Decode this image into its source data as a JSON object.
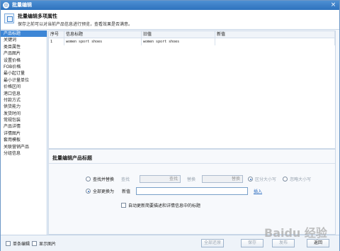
{
  "title": "批量编辑",
  "header": {
    "title": "批量编辑多项属性",
    "desc": "保存之前可以对当前产品信息进行预览，查看效果是否满意。"
  },
  "sidebar": [
    "产品标题",
    "关键词",
    "类目属性",
    "产品图片",
    "设置价格",
    "FOB价格",
    "最小起订量",
    "最小计量单位",
    "价格区间",
    "港口信息",
    "付款方式",
    "供货能力",
    "发货时间",
    "常规包装",
    "产品详情",
    "详情图片",
    "套用模板",
    "关联营销产品",
    "分组信息"
  ],
  "table": {
    "headers": [
      "序号",
      "信息标题",
      "旧值",
      "新值"
    ],
    "rows": [
      [
        "1",
        "women sport shoes",
        "women sport shoes",
        ""
      ]
    ]
  },
  "panel": {
    "title": "批量编辑产品标题",
    "find_replace": "查找并替换",
    "find": "查找",
    "find_value": "查找",
    "replace": "替换",
    "replace_value": "替换",
    "case_sensitive": "区分大小写",
    "case_ignore": "忽略大小写",
    "replace_all": "全部更换为",
    "new_value": "新值",
    "insert": "插入",
    "auto_update": "自动更新简要描述和详情信息中的标题"
  },
  "bottom": {
    "single_edit": "单条编辑",
    "show_images": "显示图片",
    "restore_all": "全部还原",
    "save": "保存",
    "publish": "发布",
    "back": "返回"
  },
  "watermark": "Baidu 经验"
}
